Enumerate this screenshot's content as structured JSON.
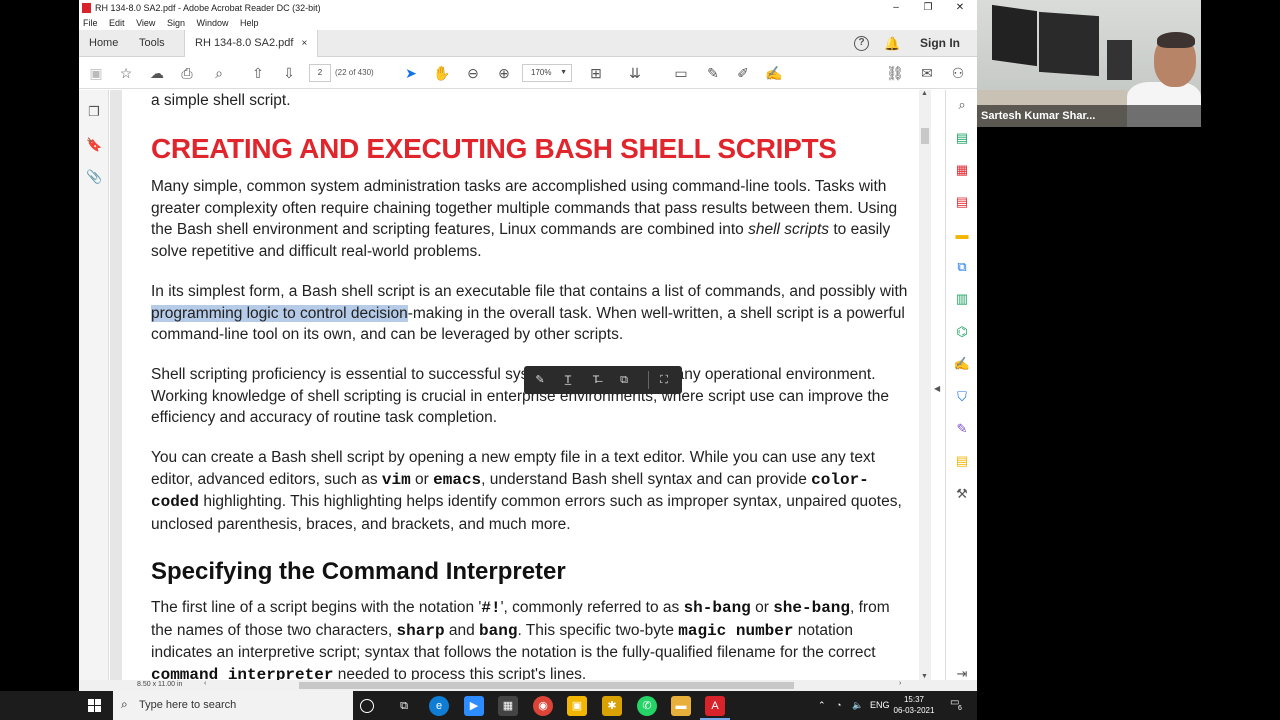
{
  "window": {
    "title": "RH 134-8.0 SA2.pdf - Adobe Acrobat Reader DC (32-bit)",
    "minimize": "–",
    "restore": "❐",
    "close": "✕"
  },
  "menu": [
    "File",
    "Edit",
    "View",
    "Sign",
    "Window",
    "Help"
  ],
  "tabs": {
    "home": "Home",
    "tools": "Tools",
    "document": "RH 134-8.0 SA2.pdf",
    "close": "×",
    "sign_in": "Sign In"
  },
  "toolbar": {
    "page_value": "2",
    "page_count": "(22 of 430)",
    "zoom": "170%"
  },
  "document": {
    "intro_tail": "a simple shell script.",
    "heading": "CREATING AND EXECUTING BASH SHELL SCRIPTS",
    "para1_a": "Many simple, common system administration tasks are accomplished using command-line tools. Tasks with greater complexity often require chaining together multiple commands that pass results between them. Using the Bash shell environment and scripting features, Linux commands are combined into ",
    "para1_em": "shell scripts",
    "para1_b": " to easily solve repetitive and difficult real-world problems.",
    "para2_a": "In its simplest form, a Bash shell script is an executable file that contains a list of commands, and possibly with ",
    "para2_hl": "programming logic to control decision",
    "para2_b": "-making in the overall task. When well-written, a shell script is a powerful command-line tool on its own, and can be leveraged by other scripts.",
    "para3": "Shell scripting proficiency is essential to successful system administration in any operational environment. Working knowledge of shell scripting is crucial in enterprise environments, where script use can improve the efficiency and accuracy of routine task completion.",
    "para4_a": "You can create a Bash shell script by opening a new empty file in a text editor. While you can use any text editor, advanced editors, such as ",
    "para4_vim": "vim",
    "para4_or": " or ",
    "para4_emacs": "emacs",
    "para4_b": ", understand Bash shell syntax and can provide ",
    "para4_cc": "color-coded",
    "para4_c": " highlighting. This highlighting helps identify common errors such as improper syntax, unpaired quotes, unclosed parenthesis, braces, and brackets, and much more.",
    "heading2": "Specifying the Command Interpreter",
    "para5_a": "The first line of a script begins with the notation '",
    "para5_hash": "#!",
    "para5_b": "', commonly referred to as ",
    "para5_shbang": "sh-bang",
    "para5_or": " or ",
    "para5_shebang": "she-bang",
    "para5_c": ", from the names of those two characters, ",
    "para5_sharp": "sharp",
    "para5_and": " and ",
    "para5_bang": "bang",
    "para5_d": ". This specific two-byte ",
    "para5_magic": "magic number",
    "para5_e": " notation indicates an interpretive script; syntax that follows the notation is the fully-qualified filename for the correct ",
    "para5_ci": "command interpreter",
    "para5_f": " needed to process this script's lines."
  },
  "statusbar": {
    "page_size": "8.50 x 11.00 in"
  },
  "video": {
    "participant": "Sartesh Kumar Shar..."
  },
  "taskbar": {
    "search_placeholder": "Type here to search",
    "lang": "ENG",
    "time": "15:37",
    "date": "06-03-2021",
    "notifications": "6"
  },
  "colors": {
    "heading_red": "#e0252d",
    "highlight": "#b6cbe8",
    "accent_blue": "#1473e6"
  }
}
